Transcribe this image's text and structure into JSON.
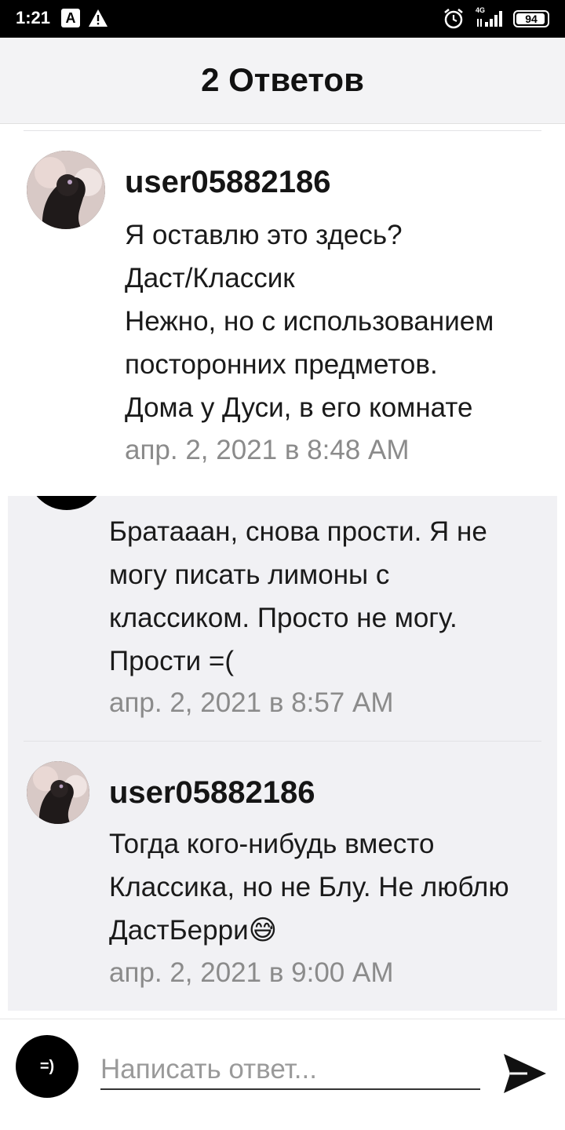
{
  "status_bar": {
    "time": "1:21",
    "app_icon_letter": "A",
    "network": "4G",
    "battery_level": "94",
    "battery_fraction": 0.94
  },
  "header": {
    "title": "2 Ответов"
  },
  "comments": [
    {
      "username": "user05882186",
      "text": "Я оставлю это здесь?\nДаст/Классик\nНежно, но с использованием посторонних предметов.\nДома у Дуси, в его комнате",
      "timestamp": "апр. 2, 2021 в 8:48 AM"
    },
    {
      "username": "",
      "text": "Братааан, снова прости. Я не могу писать лимоны с классиком. Просто не могу. Прости =(",
      "timestamp": "апр. 2, 2021 в 8:57 AM"
    },
    {
      "username": "user05882186",
      "text": "Тогда кого-нибудь вместо Классика, но не Блу. Не люблю ДастБерри😅",
      "timestamp": "апр. 2, 2021 в 9:00 AM"
    }
  ],
  "composer": {
    "avatar_text": "=)",
    "placeholder": "Написать ответ...",
    "value": ""
  },
  "colors": {
    "header_bg": "#f3f3f5",
    "reply_bg": "#f1f1f4",
    "timestamp": "#8b8b8b",
    "status_bar": "#000000"
  },
  "icons": [
    "warning-icon",
    "alarm-icon",
    "signal-icon",
    "battery-icon",
    "send-icon"
  ]
}
